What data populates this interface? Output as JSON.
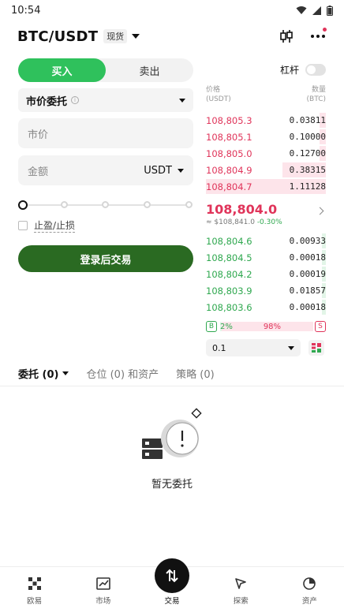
{
  "status_bar": {
    "time": "10:54"
  },
  "header": {
    "pair": "BTC/USDT",
    "badge": "现货"
  },
  "side_tabs": {
    "buy": "买入",
    "sell": "卖出"
  },
  "order_type": {
    "label": "市价委托",
    "info": "i"
  },
  "price_field": {
    "value": "市价"
  },
  "amount_field": {
    "placeholder": "金额",
    "unit": "USDT"
  },
  "tpsl": {
    "label": "止盈/止损"
  },
  "login_button": {
    "label": "登录后交易"
  },
  "leverage": {
    "label": "杠杆"
  },
  "orderbook": {
    "price_header": "价格",
    "price_unit": "(USDT)",
    "qty_header": "数量",
    "qty_unit": "(BTC)",
    "asks": [
      {
        "price": "108,805.3",
        "qty": "0.03811",
        "depth": 0.05
      },
      {
        "price": "108,805.1",
        "qty": "0.10000",
        "depth": 0.05
      },
      {
        "price": "108,805.0",
        "qty": "0.12700",
        "depth": 0.05
      },
      {
        "price": "108,804.9",
        "qty": "0.38315",
        "depth": 0.36
      },
      {
        "price": "108,804.7",
        "qty": "1.11128",
        "depth": 1.0
      }
    ],
    "last_price": "108,804.0",
    "last_fiat": "≈ $108,841.0",
    "last_change": "-0.30%",
    "bids": [
      {
        "price": "108,804.6",
        "qty": "0.00933",
        "depth": 0.03
      },
      {
        "price": "108,804.5",
        "qty": "0.00018",
        "depth": 0.03
      },
      {
        "price": "108,804.2",
        "qty": "0.00019",
        "depth": 0.03
      },
      {
        "price": "108,803.9",
        "qty": "0.01857",
        "depth": 0.03
      },
      {
        "price": "108,803.6",
        "qty": "0.00018",
        "depth": 0.03
      }
    ],
    "buy_badge": "B",
    "buy_pct": "2%",
    "sell_pct": "98%",
    "sell_badge": "S",
    "buy_ratio": 0.02,
    "depth_value": "0.1"
  },
  "order_tabs": {
    "orders": "委托 (0)",
    "positions": "仓位 (0) 和资产",
    "strategy": "策略 (0)"
  },
  "empty_state": {
    "text": "暂无委托"
  },
  "bottom_nav": {
    "okx": "欧易",
    "market": "市场",
    "trade": "交易",
    "explore": "探索",
    "assets": "资产"
  },
  "colors": {
    "buy": "#2fc15c",
    "ask": "#e0345a",
    "bid": "#2fa84f",
    "login": "#2a6a22"
  }
}
